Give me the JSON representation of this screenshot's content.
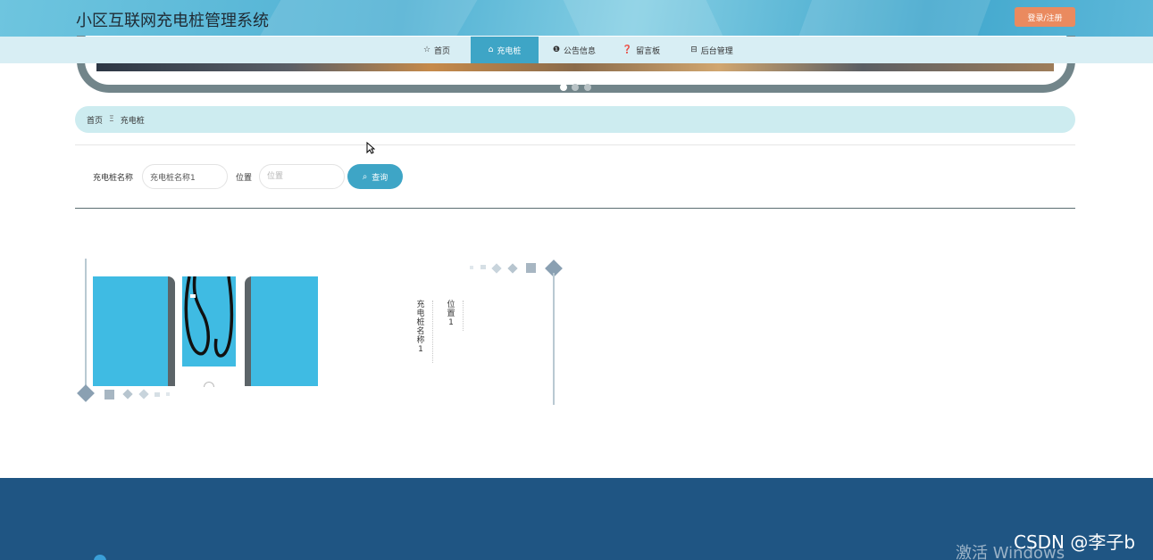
{
  "header": {
    "title": "小区互联网充电桩管理系统",
    "login_label": "登录/注册"
  },
  "nav": {
    "items": [
      {
        "label": "首页",
        "icon": "star-icon"
      },
      {
        "label": "充电桩",
        "icon": "building-icon",
        "active": true
      },
      {
        "label": "公告信息",
        "icon": "info-icon"
      },
      {
        "label": "留言板",
        "icon": "question-icon"
      },
      {
        "label": "后台管理",
        "icon": "briefcase-icon"
      }
    ]
  },
  "breadcrumb": {
    "home": "首页",
    "separator": "Ξ",
    "current": "充电桩"
  },
  "search": {
    "name_label": "充电桩名称",
    "name_value": "充电桩名称1",
    "location_label": "位置",
    "location_placeholder": "位置",
    "button_label": "查询"
  },
  "card": {
    "name": "充电桩名称1",
    "location": "位置1"
  },
  "overlay": {
    "watermark": "CSDN @李子b",
    "activate": "激活 Windows"
  },
  "colors": {
    "primary": "#3ea5c6",
    "login": "#ea8a5f",
    "footer": "#1f5583",
    "panel": "#3fbbe3"
  }
}
